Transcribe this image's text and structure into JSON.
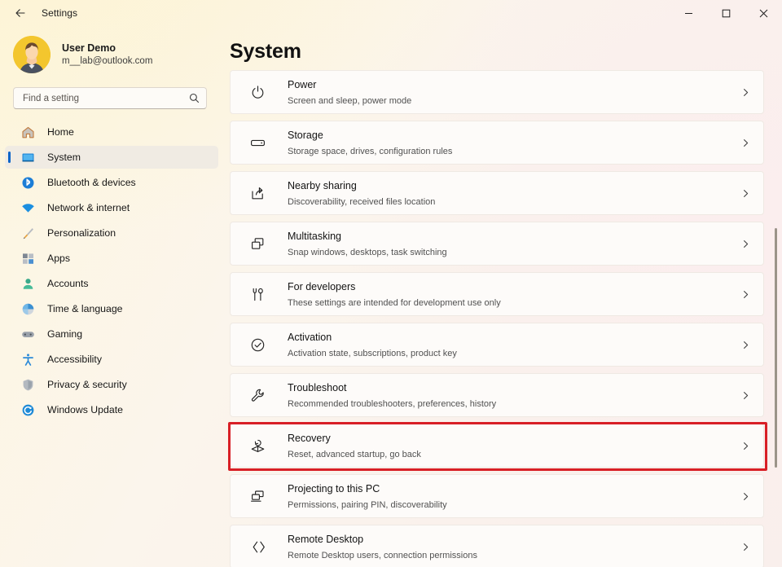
{
  "titlebar": {
    "back_label": "back-arrow",
    "app_title": "Settings",
    "minimize": "minimize-icon",
    "maximize": "maximize-icon",
    "close": "close-icon"
  },
  "account": {
    "name": "User Demo",
    "email": "m__lab@outlook.com",
    "avatar": "user-avatar"
  },
  "search": {
    "placeholder": "Find a setting",
    "value": "",
    "icon": "search-icon"
  },
  "sidebar": {
    "items": [
      {
        "label": "Home",
        "icon": "home-icon",
        "active": false
      },
      {
        "label": "System",
        "icon": "system-monitor-icon",
        "active": true
      },
      {
        "label": "Bluetooth & devices",
        "icon": "bluetooth-icon",
        "active": false
      },
      {
        "label": "Network & internet",
        "icon": "wifi-icon",
        "active": false
      },
      {
        "label": "Personalization",
        "icon": "paintbrush-icon",
        "active": false
      },
      {
        "label": "Apps",
        "icon": "apps-grid-icon",
        "active": false
      },
      {
        "label": "Accounts",
        "icon": "person-icon",
        "active": false
      },
      {
        "label": "Time & language",
        "icon": "clock-globe-icon",
        "active": false
      },
      {
        "label": "Gaming",
        "icon": "gamepad-icon",
        "active": false
      },
      {
        "label": "Accessibility",
        "icon": "accessibility-icon",
        "active": false
      },
      {
        "label": "Privacy & security",
        "icon": "shield-icon",
        "active": false
      },
      {
        "label": "Windows Update",
        "icon": "update-refresh-icon",
        "active": false
      }
    ]
  },
  "main": {
    "title": "System",
    "cards": [
      {
        "title": "Power",
        "subtitle": "Screen and sleep, power mode",
        "icon": "power-icon"
      },
      {
        "title": "Storage",
        "subtitle": "Storage space, drives, configuration rules",
        "icon": "drive-icon"
      },
      {
        "title": "Nearby sharing",
        "subtitle": "Discoverability, received files location",
        "icon": "share-icon"
      },
      {
        "title": "Multitasking",
        "subtitle": "Snap windows, desktops, task switching",
        "icon": "windows-stack-icon"
      },
      {
        "title": "For developers",
        "subtitle": "These settings are intended for development use only",
        "icon": "tools-icon"
      },
      {
        "title": "Activation",
        "subtitle": "Activation state, subscriptions, product key",
        "icon": "checkmark-circle-icon"
      },
      {
        "title": "Troubleshoot",
        "subtitle": "Recommended troubleshooters, preferences, history",
        "icon": "wrench-icon"
      },
      {
        "title": "Recovery",
        "subtitle": "Reset, advanced startup, go back",
        "icon": "recovery-icon",
        "highlighted": true
      },
      {
        "title": "Projecting to this PC",
        "subtitle": "Permissions, pairing PIN, discoverability",
        "icon": "projecting-icon"
      },
      {
        "title": "Remote Desktop",
        "subtitle": "Remote Desktop users, connection permissions",
        "icon": "remote-desktop-icon"
      }
    ],
    "chevron": "chevron-right-icon"
  },
  "colors": {
    "accent": "#0a64c8",
    "highlight": "#d81f26",
    "card_bg": "#fdfbf9",
    "selected_nav_bg": "#f0ebe3"
  }
}
